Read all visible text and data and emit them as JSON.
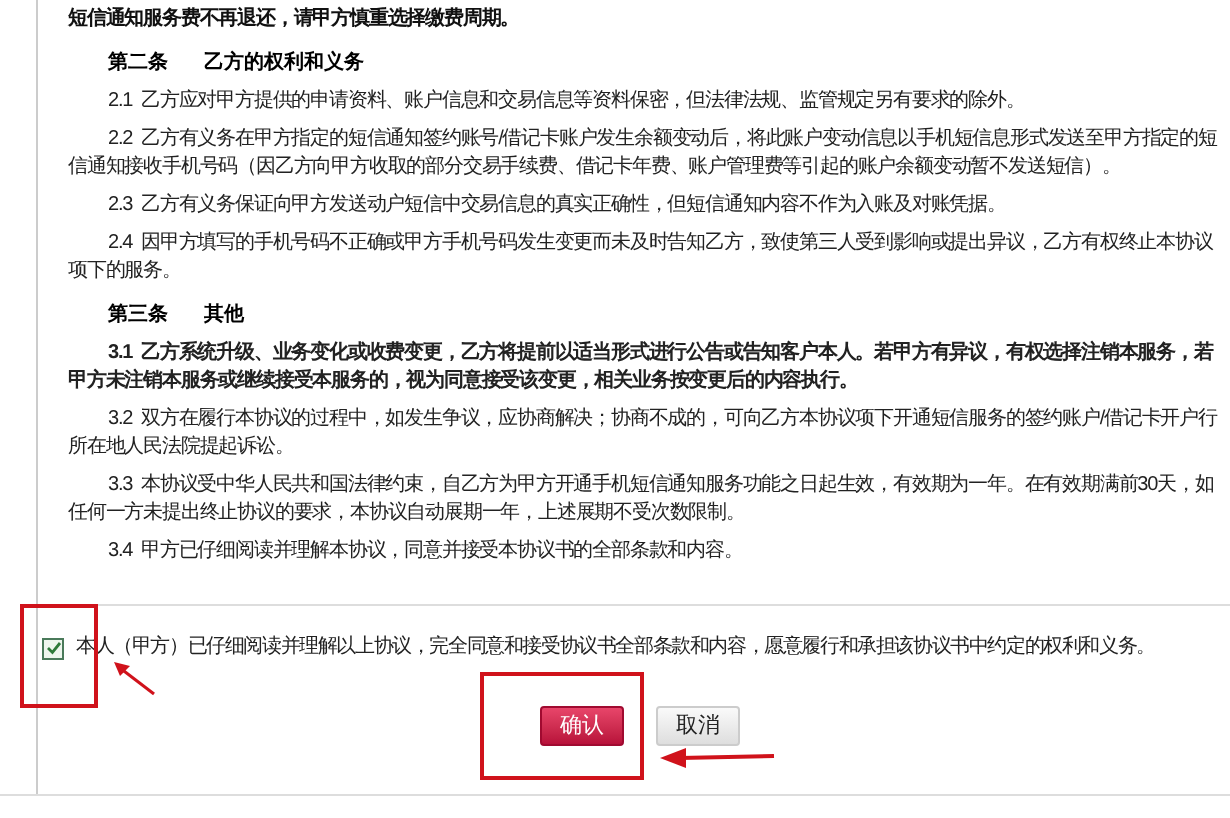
{
  "intro": "短信通知服务费不再退还，请甲方慎重选择缴费周期。",
  "sections": [
    {
      "number": "第二条",
      "title": "乙方的权利和义务",
      "paragraphs": [
        {
          "number": "2.1",
          "text": "乙方应对甲方提供的申请资料、账户信息和交易信息等资料保密，但法律法规、监管规定另有要求的除外。",
          "bold": false
        },
        {
          "number": "2.2",
          "text": "乙方有义务在甲方指定的短信通知签约账号/借记卡账户发生余额变动后，将此账户变动信息以手机短信息形式发送至甲方指定的短信通知接收手机号码（因乙方向甲方收取的部分交易手续费、借记卡年费、账户管理费等引起的账户余额变动暂不发送短信）。",
          "bold": false
        },
        {
          "number": "2.3",
          "text": "乙方有义务保证向甲方发送动户短信中交易信息的真实正确性，但短信通知内容不作为入账及对账凭据。",
          "bold": false
        },
        {
          "number": "2.4",
          "text": "因甲方填写的手机号码不正确或甲方手机号码发生变更而未及时告知乙方，致使第三人受到影响或提出异议，乙方有权终止本协议项下的服务。",
          "bold": false
        }
      ]
    },
    {
      "number": "第三条",
      "title": "其他",
      "paragraphs": [
        {
          "number": "3.1",
          "text": "乙方系统升级、业务变化或收费变更，乙方将提前以适当形式进行公告或告知客户本人。若甲方有异议，有权选择注销本服务，若甲方未注销本服务或继续接受本服务的，视为同意接受该变更，相关业务按变更后的内容执行。",
          "bold": true
        },
        {
          "number": "3.2",
          "text": "双方在履行本协议的过程中，如发生争议，应协商解决；协商不成的，可向乙方本协议项下开通短信服务的签约账户/借记卡开户行所在地人民法院提起诉讼。",
          "bold": false
        },
        {
          "number": "3.3",
          "text": "本协议受中华人民共和国法律约束，自乙方为甲方开通手机短信通知服务功能之日起生效，有效期为一年。在有效期满前30天，如任何一方未提出终止协议的要求，本协议自动展期一年，上述展期不受次数限制。",
          "bold": false
        },
        {
          "number": "3.4",
          "text": "甲方已仔细阅读并理解本协议，同意并接受本协议书的全部条款和内容。",
          "bold": false
        }
      ]
    }
  ],
  "agreement": {
    "checked": true,
    "label": "本人（甲方）已仔细阅读并理解以上协议，完全同意和接受协议书全部条款和内容，愿意履行和承担该协议书中约定的权利和义务。"
  },
  "buttons": [
    {
      "kind": "primary",
      "label": "确认"
    },
    {
      "kind": "secondary",
      "label": "取消"
    }
  ]
}
